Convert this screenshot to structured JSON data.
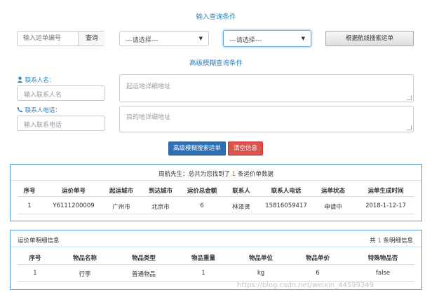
{
  "query": {
    "title": "输入查询条件",
    "waybill_placeholder": "输入运单编号",
    "query_button": "查询",
    "select1_value": "---请选择---",
    "select2_value": "---请选择---",
    "route_search_button": "根据航线搜索运单"
  },
  "fuzzy": {
    "title": "高级模糊查询条件",
    "contact_name_label": "联系人名：",
    "contact_name_placeholder": "输入联系人名",
    "contact_phone_label": "联系人电话：",
    "contact_phone_placeholder": "输入联系电话",
    "origin_placeholder": "起运地详细地址",
    "dest_placeholder": "目的地详细地址",
    "search_button": "高级模糊搜索运单",
    "clear_button": "清空信息"
  },
  "results": {
    "summary_prefix": "周航先生：总共为您找到了",
    "summary_count": "1",
    "summary_suffix": "条运价单数据",
    "columns": [
      "序号",
      "运价单号",
      "起运城市",
      "到达城市",
      "运价总金额",
      "联系人",
      "联系人电话",
      "运单状态",
      "运单生成时间"
    ],
    "rows": [
      [
        "1",
        "Y6111200009",
        "广州市",
        "北京市",
        "6",
        "林泽贤",
        "15816059417",
        "申请中",
        "2018-1-12-17"
      ]
    ]
  },
  "detail": {
    "title": "运价单明细信息",
    "count_prefix": "共",
    "count_value": "1",
    "count_suffix": "条明细信息",
    "columns": [
      "序号",
      "物品名称",
      "物品类型",
      "物品重量",
      "物品单位",
      "物品单价",
      "特殊物品否"
    ],
    "rows": [
      [
        "1",
        "行李",
        "普通物品",
        "1",
        "kg",
        "6",
        "false"
      ]
    ]
  },
  "watermark": "https://blog.csdn.net/weixin_44599349",
  "icons": {
    "person": "user-icon",
    "phone": "phone-icon"
  }
}
